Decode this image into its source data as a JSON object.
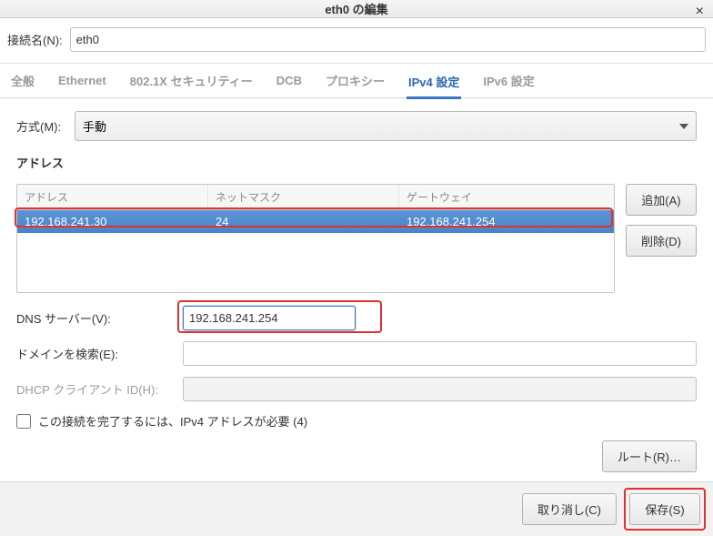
{
  "window": {
    "title": "eth0 の編集"
  },
  "connection": {
    "label": "接続名(N):",
    "value": "eth0"
  },
  "tabs": {
    "general": "全般",
    "ethernet": "Ethernet",
    "security": "802.1X セキュリティー",
    "dcb": "DCB",
    "proxy": "プロキシー",
    "ipv4": "IPv4 設定",
    "ipv6": "IPv6 設定"
  },
  "method": {
    "label": "方式(M):",
    "value": "手動"
  },
  "addresses": {
    "heading": "アドレス",
    "headers": {
      "address": "アドレス",
      "netmask": "ネットマスク",
      "gateway": "ゲートウェイ"
    },
    "rows": [
      {
        "address": "192.168.241.30",
        "netmask": "24",
        "gateway": "192.168.241.254"
      }
    ],
    "add_label": "追加(A)",
    "delete_label": "削除(D)"
  },
  "dns": {
    "label": "DNS サーバー(V):",
    "value": "192.168.241.254"
  },
  "search": {
    "label": "ドメインを検索(E):",
    "value": ""
  },
  "dhcp": {
    "label": "DHCP クライアント ID(H):",
    "value": ""
  },
  "require": {
    "label": "この接続を完了するには、IPv4 アドレスが必要 (4)",
    "checked": false
  },
  "routes": {
    "label": "ルート(R)…"
  },
  "footer": {
    "cancel": "取り消し(C)",
    "save": "保存(S)"
  }
}
